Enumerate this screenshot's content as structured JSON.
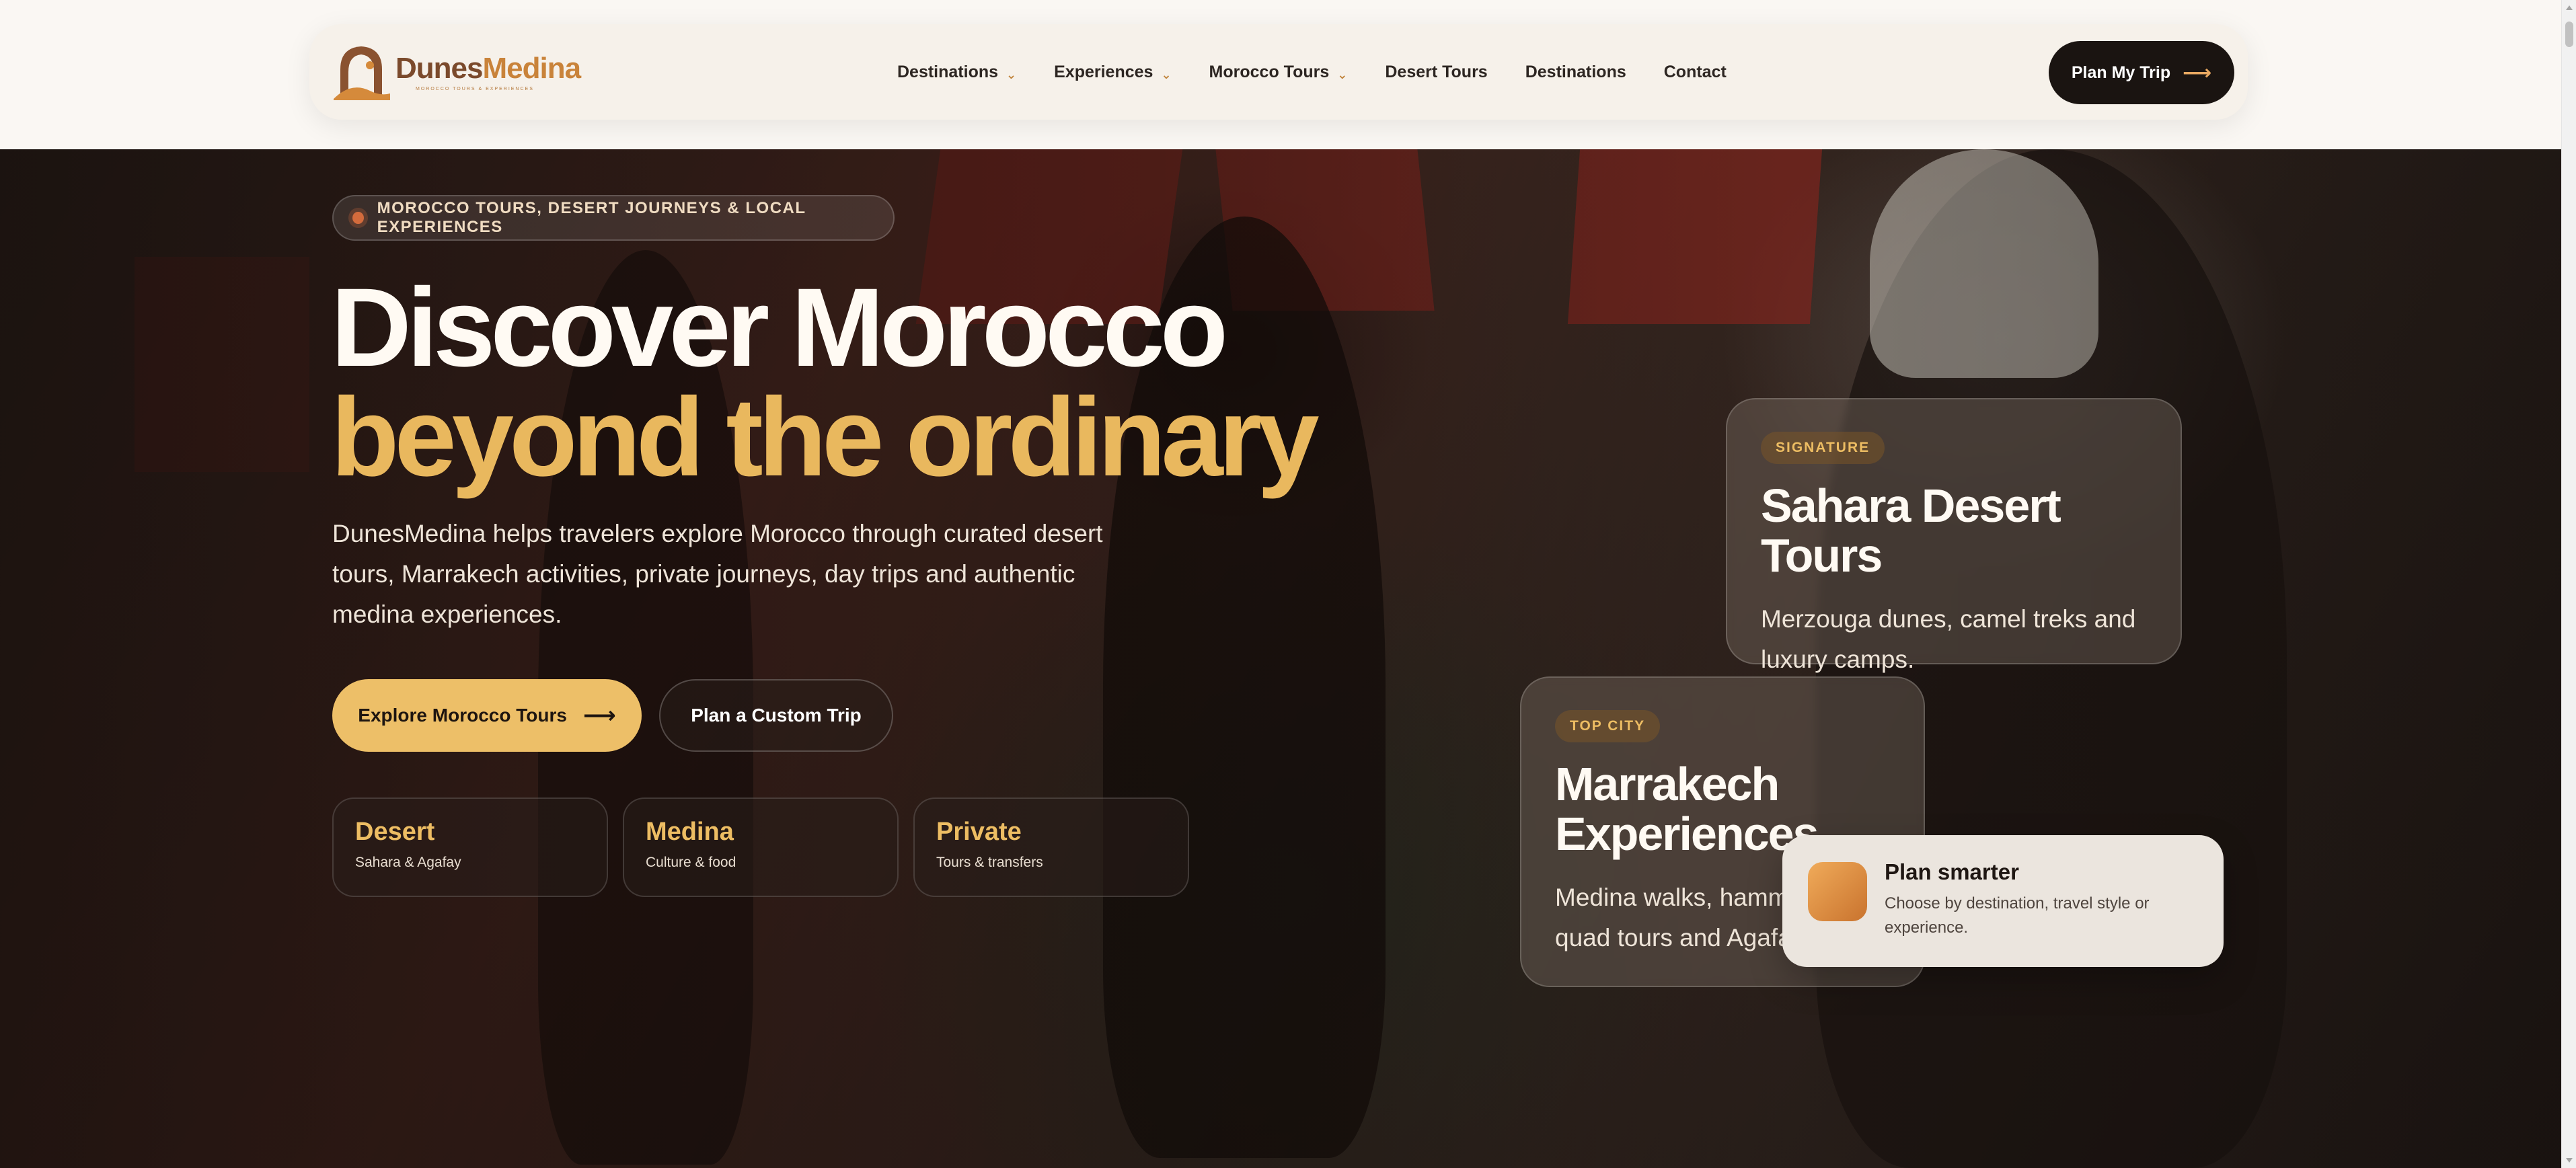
{
  "header": {
    "logo": {
      "name_part1": "Dunes",
      "name_part2": "Medina",
      "tagline": "MOROCCO TOURS & EXPERIENCES"
    },
    "nav": [
      {
        "label": "Destinations",
        "has_dropdown": true
      },
      {
        "label": "Experiences",
        "has_dropdown": true
      },
      {
        "label": "Morocco Tours",
        "has_dropdown": true
      },
      {
        "label": "Desert Tours",
        "has_dropdown": false
      },
      {
        "label": "Destinations",
        "has_dropdown": false
      },
      {
        "label": "Contact",
        "has_dropdown": false
      }
    ],
    "cta": {
      "label": "Plan My Trip",
      "arrow": "⟶"
    }
  },
  "hero": {
    "eyebrow": "MOROCCO TOURS, DESERT JOURNEYS & LOCAL EXPERIENCES",
    "title_line1": "Discover Morocco",
    "title_line2": "beyond the ordinary",
    "lead": "DunesMedina helps travelers explore Morocco through curated desert tours, Marrakech activities, private journeys, day trips and authentic medina experiences.",
    "primary_button": {
      "label": "Explore Morocco Tours",
      "arrow": "⟶"
    },
    "secondary_button": {
      "label": "Plan a Custom Trip"
    },
    "stats": [
      {
        "title": "Desert",
        "subtitle": "Sahara & Agafay"
      },
      {
        "title": "Medina",
        "subtitle": "Culture & food"
      },
      {
        "title": "Private",
        "subtitle": "Tours & transfers"
      }
    ]
  },
  "cards": {
    "signature": {
      "badge": "SIGNATURE",
      "title": "Sahara Desert Tours",
      "description": "Merzouga dunes, camel treks and luxury camps."
    },
    "top_city": {
      "badge": "TOP CITY",
      "title_line1": "Marrakech",
      "title_line2": "Experiences",
      "description": "Medina walks, hammam, quad tours and Agafay."
    }
  },
  "plan_card": {
    "title": "Plan smarter",
    "description": "Choose by destination, travel style or experience."
  },
  "colors": {
    "accent_gold": "#edbf68",
    "dark": "#1a1411",
    "brand_brown": "#7b4a2c",
    "brand_orange": "#c9833a"
  },
  "icons": {
    "chevron": "chevron-down-icon",
    "arrow": "arrow-right-icon",
    "eyebrow_dot": "dot-icon",
    "plan_icon": "planner-icon"
  }
}
